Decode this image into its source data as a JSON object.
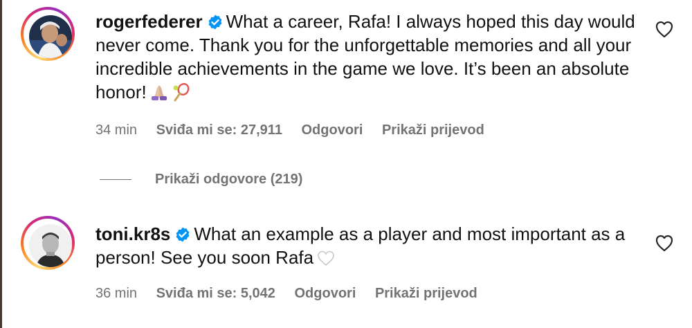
{
  "comments": [
    {
      "username": "rogerfederer",
      "verified": true,
      "text": "What a career, Rafa! I always hoped this day would never come. Thank you for the unforgettable memories and all your incredible achievements in the game we love. It’s been an absolute honor!",
      "emojis": [
        "folded-hands-emoji",
        "tennis-racket-emoji"
      ],
      "time": "34 min",
      "likes": "Sviđa mi se: 27,911",
      "reply_label": "Odgovori",
      "translate_label": "Prikaži prijevod",
      "view_replies": "Prikaži odgovore (219)"
    },
    {
      "username": "toni.kr8s",
      "verified": true,
      "text": "What an example as a player and most important as a person! See you soon Rafa",
      "emojis": [
        "white-heart-emoji"
      ],
      "time": "36 min",
      "likes": "Sviđa mi se: 5,042",
      "reply_label": "Odgovori",
      "translate_label": "Prikaži prijevod"
    }
  ],
  "colors": {
    "verified_badge": "#0095f6",
    "meta_text": "#737373",
    "primary_text": "#111111"
  },
  "icons": {
    "like": "heart-outline-icon",
    "verified": "verified-badge-icon"
  }
}
